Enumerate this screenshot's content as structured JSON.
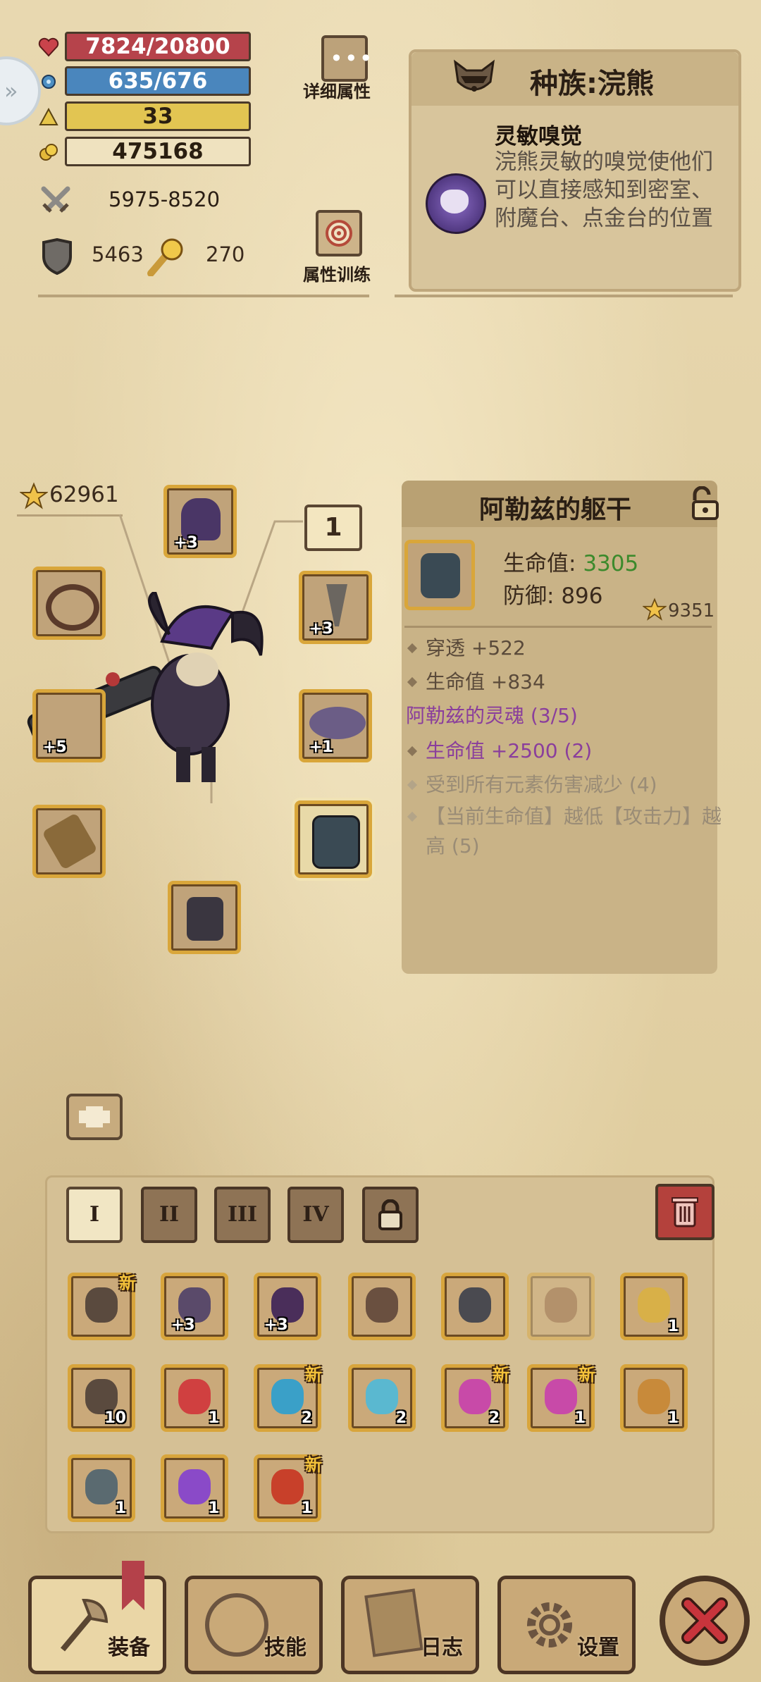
{
  "stats": {
    "hp": "7824/20800",
    "mana": "635/676",
    "level": "33",
    "gold": "475168",
    "attack": "5975-8520",
    "defense": "5463",
    "power": "270"
  },
  "buttons": {
    "details_label": "详细属性",
    "training_label": "属性训练"
  },
  "race": {
    "title": "种族:浣熊",
    "skill_name": "灵敏嗅觉",
    "skill_desc": "浣熊灵敏的嗅觉使他们可以直接感知到密室、附魔台、点金台的位置"
  },
  "character": {
    "score": "62961",
    "slot_badge": "1"
  },
  "equipment_slots": [
    {
      "name": "helmet",
      "plus": "+3"
    },
    {
      "name": "necklace",
      "plus": "+3"
    },
    {
      "name": "shoulder",
      "plus": "+1"
    },
    {
      "name": "weapon",
      "plus": "+5"
    }
  ],
  "item_detail": {
    "name": "阿勒兹的躯干",
    "hp_label": "生命值:",
    "hp_value": "3305",
    "def_label": "防御:",
    "def_value": "896",
    "score": "9351",
    "attr1": "穿透 +522",
    "attr2": "生命值 +834",
    "set_name": "阿勒兹的灵魂 (3/5)",
    "set1": "生命值 +2500 (2)",
    "set2": "受到所有元素伤害减少 (4)",
    "set3": "【当前生命值】越低【攻击力】越高 (5)"
  },
  "tabs": [
    "I",
    "II",
    "III",
    "IV"
  ],
  "inventory": [
    {
      "name": "crossbow-icon",
      "new": "新",
      "count": "",
      "plus": ""
    },
    {
      "name": "horned-helmet-icon",
      "new": "",
      "count": "",
      "plus": "+3"
    },
    {
      "name": "dark-helmet-icon",
      "new": "",
      "count": "",
      "plus": "+3"
    },
    {
      "name": "chest-armor-icon",
      "new": "",
      "count": "",
      "plus": ""
    },
    {
      "name": "eye-helmet-icon",
      "new": "",
      "count": "",
      "plus": ""
    },
    {
      "name": "meat-icon",
      "new": "",
      "count": "",
      "plus": ""
    },
    {
      "name": "scroll-gold-icon",
      "new": "",
      "count": "1",
      "plus": ""
    },
    {
      "name": "pickaxe-icon",
      "new": "",
      "count": "10",
      "plus": ""
    },
    {
      "name": "red-potion-icon",
      "new": "",
      "count": "1",
      "plus": ""
    },
    {
      "name": "eye-scroll-icon",
      "new": "新",
      "count": "2",
      "plus": ""
    },
    {
      "name": "blue-potion-icon",
      "new": "",
      "count": "2",
      "plus": ""
    },
    {
      "name": "pink-potion-icon",
      "new": "新",
      "count": "2",
      "plus": ""
    },
    {
      "name": "pink-potion-large-icon",
      "new": "新",
      "count": "1",
      "plus": ""
    },
    {
      "name": "bread-icon",
      "new": "",
      "count": "1",
      "plus": ""
    },
    {
      "name": "lightning-potion-icon",
      "new": "",
      "count": "1",
      "plus": ""
    },
    {
      "name": "purple-potion-icon",
      "new": "",
      "count": "1",
      "plus": ""
    },
    {
      "name": "fire-rune-icon",
      "new": "新",
      "count": "1",
      "plus": ""
    }
  ],
  "nav": {
    "equip": "装备",
    "skills": "技能",
    "log": "日志",
    "settings": "设置"
  }
}
